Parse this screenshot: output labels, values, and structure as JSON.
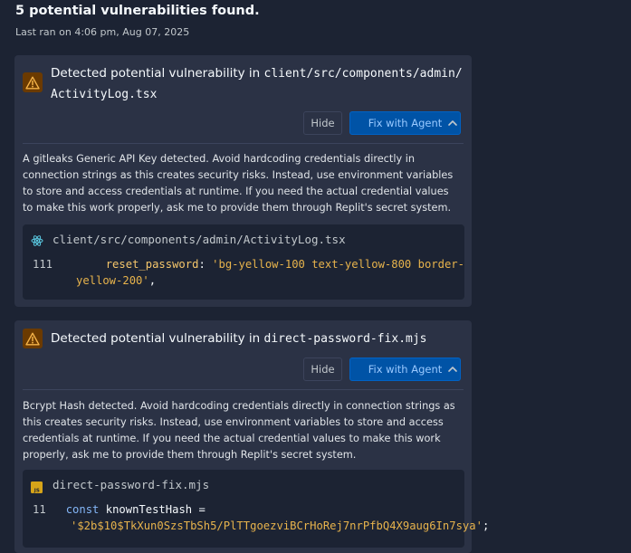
{
  "summary": {
    "title": "5 potential vulnerabilities found.",
    "last_ran": "Last ran on 4:06 pm, Aug 07, 2025"
  },
  "vulnerabilities": [
    {
      "title_prefix": "Detected potential vulnerability in ",
      "title_path_line1": "client/src/components/admin/",
      "title_path_line2": "ActivityLog.tsx",
      "hide_label": "Hide",
      "fix_label": "Fix with Agent",
      "description": "A gitleaks Generic API Key detected. Avoid hardcoding credentials directly in connection strings as this creates security risks. Instead, use environment variables to store and access credentials at runtime. If you need the actual credential values to make this work properly, ask me to provide them through Replit's secret system.",
      "file_icon": "react-icon",
      "file_path": "client/src/components/admin/ActivityLog.tsx",
      "line_number": "111",
      "code_key": "reset_password",
      "code_sep": ": ",
      "code_value": "'bg-yellow-100 text-yellow-800 border-yellow-200'",
      "code_end": ","
    },
    {
      "title_prefix": "Detected potential vulnerability in ",
      "title_path": "direct-password-fix.mjs",
      "hide_label": "Hide",
      "fix_label": "Fix with Agent",
      "description": "Bcrypt Hash detected. Avoid hardcoding credentials directly in connection strings as this creates security risks. Instead, use environment variables to store and access credentials at runtime. If you need the actual credential values to make this work properly, ask me to provide them through Replit's secret system.",
      "file_icon": "javascript-icon",
      "file_icon_text": "JS",
      "file_path": "direct-password-fix.mjs",
      "line_number": "11",
      "code_keyword": "const",
      "code_ident": "knownTestHash",
      "code_eq": " = ",
      "code_value": "'$2b$10$TkXun0SzsTbSh5/PlTTgoezviBCrHoRej7nrPfbQ4X9aug6In7sya'",
      "code_end": ";"
    }
  ],
  "colors": {
    "background": "#1c2333",
    "card": "#2b3245",
    "primary_button": "#0053a6",
    "warning": "#6b3a00",
    "code_string": "#e7b34c",
    "code_keyword": "#84b6f7"
  }
}
